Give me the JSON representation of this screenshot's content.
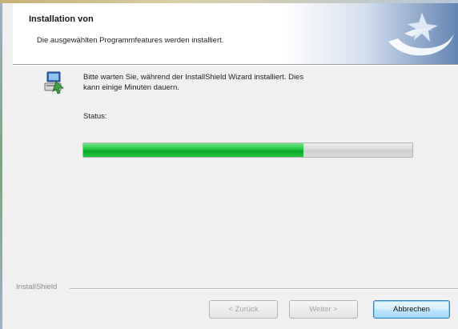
{
  "header": {
    "title": "Installation von",
    "subtitle": "Die ausgewählten Programmfeatures werden installiert.",
    "logo_icon": "installshield-logo-icon"
  },
  "main": {
    "icon": "setup-computer-icon",
    "message_line1": "Bitte warten Sie, während der InstallShield Wizard installiert. Dies",
    "message_line2": "kann einige Minuten dauern.",
    "status_label": "Status:",
    "progress_percent": 67
  },
  "footer": {
    "brand": "InstallShield",
    "back_label": "< Zurück",
    "next_label": "Weiter >",
    "cancel_label": "Abbrechen"
  },
  "colors": {
    "progress_green": "#22c53f",
    "header_accent": "#6082b2",
    "default_button_border": "#3c7fb1"
  }
}
